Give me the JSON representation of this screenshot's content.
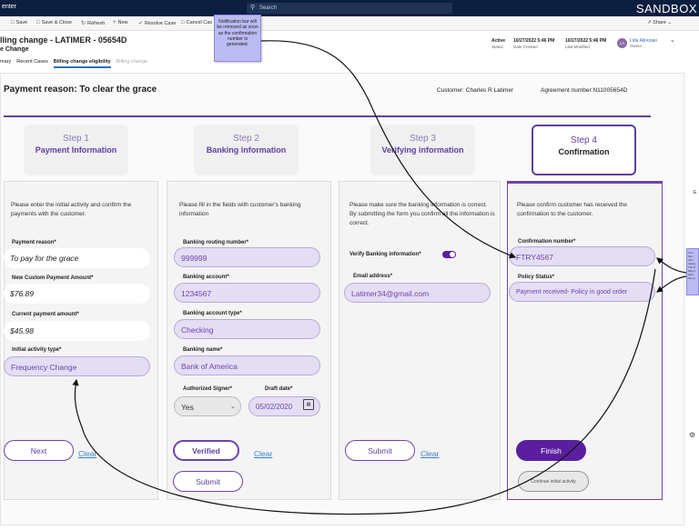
{
  "topbar": {
    "app_name": "enter",
    "search_placeholder": "Search",
    "sandbox": "SANDBOX"
  },
  "cmdbar": {
    "save": "Save",
    "save_close": "Save & Close",
    "refresh": "Refresh",
    "new": "New",
    "resolve": "Resolve Case",
    "cancel": "Cancel Cas",
    "share": "Share"
  },
  "record": {
    "title": "lling change - LATIMER - 05654D",
    "subtitle": "e Change",
    "tabs": [
      "mary",
      "Recent Cases",
      "Billing change eligibility",
      "Billing change"
    ],
    "status_value": "Active",
    "status_label": "Status",
    "created_value": "10/27/2022 5:46 PM",
    "created_label": "Date Created",
    "modified_value": "10/27/2022 5:46 PM",
    "modified_label": "Last Modified",
    "owner_initials": "LA",
    "owner_name": "Lida Alirezaei",
    "owner_label": "Owner"
  },
  "note_top": "Notification bar will be removed as soon as the confirmation number is generated.",
  "note_side": "Con the r will f status The P flag) p alert the cu",
  "side_letter": "E",
  "payment_reason_header": "Payment reason: To clear the grace",
  "customer": "Customer: Charles R Latimer",
  "agreement": "Agreement number:N11005654D",
  "steps": [
    {
      "step": "Step 1",
      "title": "Payment Information"
    },
    {
      "step": "Step 2",
      "title": "Banking information"
    },
    {
      "step": "Step 3",
      "title": "Verifying information"
    },
    {
      "step": "Step 4",
      "title": "Confirmation"
    }
  ],
  "panel1": {
    "intro": "Please enter the initial activity and confirm the payments with the customer.",
    "reason_label": "Payment reason*",
    "reason_value": "To pay for the grace",
    "custom_label": "New Custom Payment Amount*",
    "custom_value": "$76.89",
    "current_label": "Current payment amount*",
    "current_value": "$45.98",
    "activity_label": "Initial activity type*",
    "activity_value": "Frequency Change",
    "next": "Next",
    "clear": "Clear"
  },
  "panel2": {
    "intro": "Please fill in the fields with customer's banking information",
    "routing_label": "Banking routing number*",
    "routing_value": "999999",
    "account_label": "Banking account*",
    "account_value": "1234567",
    "type_label": "Banking account type*",
    "type_value": "Checking",
    "name_label": "Banking name*",
    "name_value": "Bank of America",
    "signer_label": "Authorized Signer*",
    "signer_value": "Yes",
    "draft_label": "Draft date*",
    "draft_value": "05/02/2020",
    "verified": "Verified",
    "clear": "Clear",
    "submit": "Submit"
  },
  "panel3": {
    "intro": "Please make sure the banking information is correct. By submitting the form you confirm all the information is correct.",
    "verify_label": "Verify Banking information*",
    "email_label": "Email address*",
    "email_value": "Latimer34@gmail.com",
    "submit": "Submit",
    "clear": "Clear"
  },
  "panel4": {
    "intro": "Please confirm customer has received the confirmation to the customer.",
    "conf_label": "Confirmation number*",
    "conf_value": "FTRY4567",
    "policy_label": "Policy Status*",
    "policy_value": "Payment received- Policy in good order",
    "finish": "Finish",
    "continue": "Continue initial activity"
  },
  "colors": {
    "accent": "#5e3fa0",
    "button_dark": "#5a1f9e",
    "field_lavender": "#e4ddf3",
    "note": "#bcbaf2",
    "topbar": "#0b1e3f"
  }
}
